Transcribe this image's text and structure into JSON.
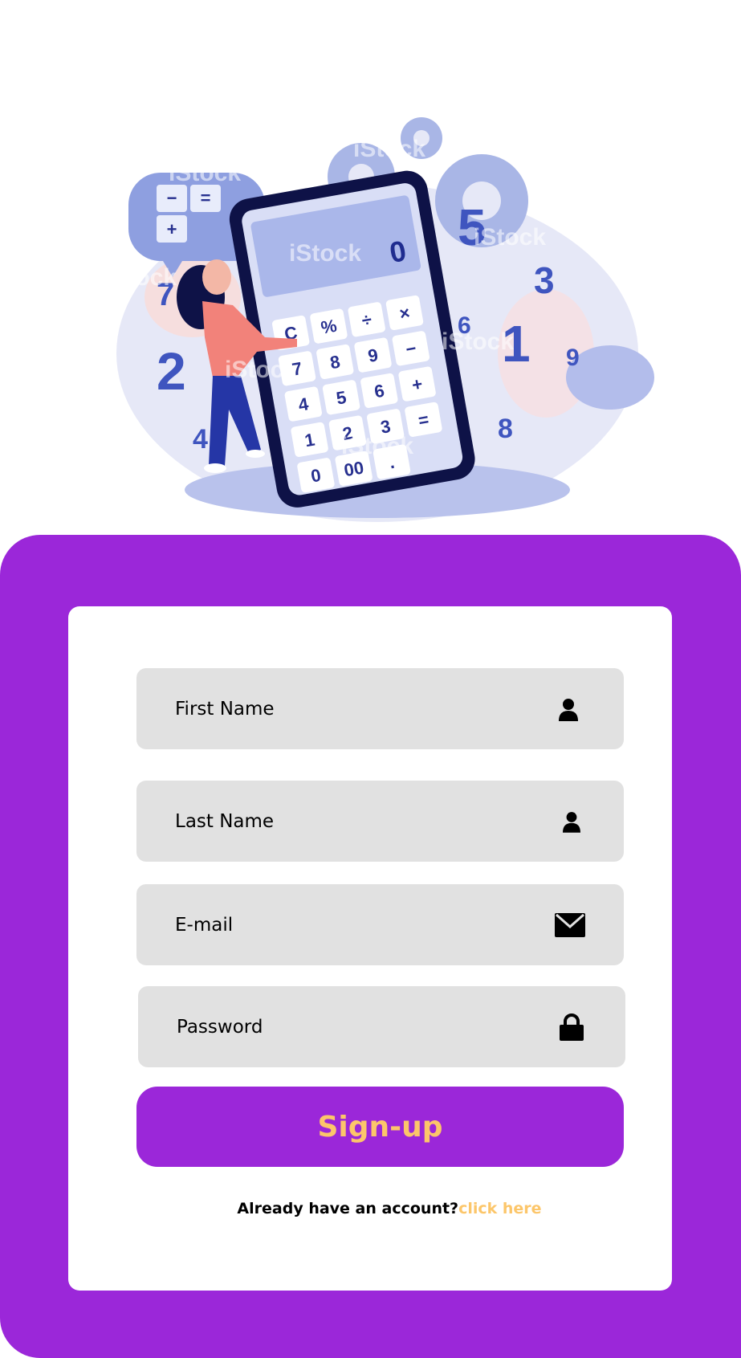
{
  "form": {
    "first_name_placeholder": "First Name",
    "last_name_placeholder": "Last Name",
    "email_placeholder": "E-mail",
    "password_placeholder": "Password",
    "submit_label": "Sign-up",
    "account_prompt": "Already have an account?",
    "login_link": "click here"
  },
  "icons": {
    "first_name": "user-icon",
    "last_name": "user-icon",
    "email": "envelope-icon",
    "password": "lock-icon"
  },
  "illustration": {
    "display": "0",
    "keys": [
      "C",
      "%",
      "÷",
      "×",
      "7",
      "8",
      "9",
      "−",
      "4",
      "5",
      "6",
      "+",
      "1",
      "2",
      "3",
      "=",
      "0",
      "00",
      "."
    ],
    "bubble_symbols": [
      "−",
      "=",
      "+"
    ],
    "floating_numbers": [
      "5",
      "3",
      "6",
      "1",
      "9",
      "8",
      "7",
      "2",
      "4"
    ],
    "watermark": "iStock"
  },
  "colors": {
    "brand_purple": "#9b27d9",
    "accent_yellow": "#fcc66a",
    "field_gray": "#e1e1e1",
    "card_white": "#ffffff"
  }
}
